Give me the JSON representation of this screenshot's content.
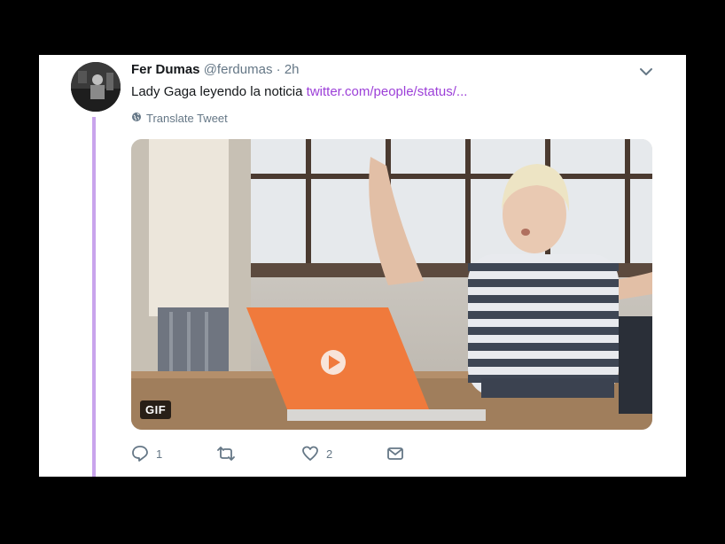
{
  "tweet": {
    "name": "Fer Dumas",
    "handle": "@ferdumas",
    "separator": "·",
    "time": "2h",
    "text": "Lady Gaga leyendo la noticia",
    "link": "twitter.com/people/status/...",
    "translate_label": "Translate Tweet"
  },
  "media": {
    "badge": "GIF"
  },
  "actions": {
    "reply_count": "1",
    "retweet_count": "",
    "like_count": "2"
  },
  "icons": [
    "chevron-down-icon",
    "globe-icon",
    "play-icon",
    "reply-icon",
    "retweet-icon",
    "like-icon",
    "message-icon"
  ],
  "colors": {
    "background": "#000000",
    "card": "#ffffff",
    "link": "#9c3fd8",
    "thread_line": "#c9a4ec",
    "muted": "#657786"
  }
}
